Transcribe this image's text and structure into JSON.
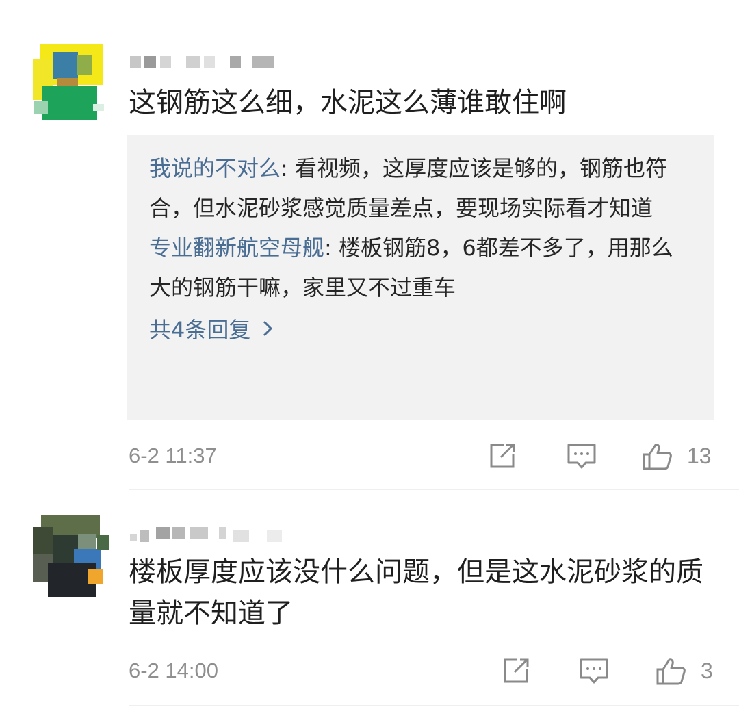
{
  "comments": [
    {
      "text": "这钢筋这么细，水泥这么薄谁敢住啊",
      "replies": [
        {
          "user": "我说的不对么",
          "sep": ": ",
          "text": "看视频，这厚度应该是够的，钢筋也符合，但水泥砂浆感觉质量差点，要现场实际看才知道"
        },
        {
          "user": "专业翻新航空母舰",
          "sep": ": ",
          "text": "楼板钢筋8，6都差不多了，用那么大的钢筋干嘛，家里又不过重车"
        }
      ],
      "more_replies": "共4条回复",
      "time": "6-2 11:37",
      "likes": "13"
    },
    {
      "text": "楼板厚度应该没什么问题，但是这水泥砂浆的质量就不知道了",
      "time": "6-2 14:00",
      "likes": "3"
    }
  ],
  "icons": {
    "share": "share-icon",
    "comment": "comment-icon",
    "like": "thumbs-up-icon",
    "more": "chevron-right-icon"
  },
  "colors": {
    "link": "#4a6d94",
    "meta": "#8f8f8f",
    "reply_bg": "#f2f2f2"
  }
}
